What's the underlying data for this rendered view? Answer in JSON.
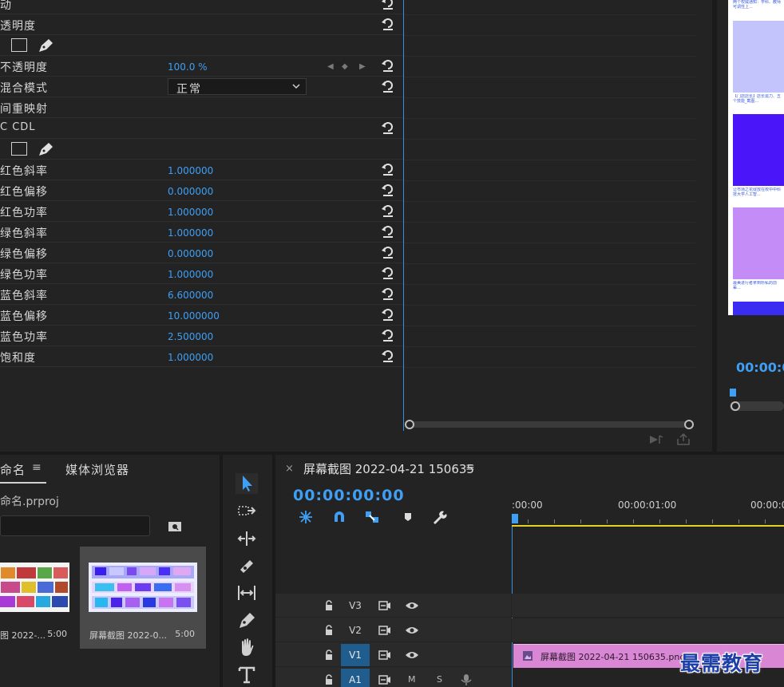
{
  "effect_controls": {
    "rows": [
      {
        "label": "动",
        "value": ""
      },
      {
        "label": "透明度",
        "value": ""
      },
      {
        "label": "",
        "value": ""
      },
      {
        "label": "不透明度",
        "value": "100.0 %"
      },
      {
        "label": "混合模式",
        "value": ""
      },
      {
        "label": "间重映射",
        "value": ""
      },
      {
        "label": "C CDL",
        "value": ""
      },
      {
        "label": "",
        "value": ""
      },
      {
        "label": "红色斜率",
        "value": "1.000000"
      },
      {
        "label": "红色偏移",
        "value": "0.000000"
      },
      {
        "label": "红色功率",
        "value": "1.000000"
      },
      {
        "label": "绿色斜率",
        "value": "1.000000"
      },
      {
        "label": "绿色偏移",
        "value": "0.000000"
      },
      {
        "label": "绿色功率",
        "value": "1.000000"
      },
      {
        "label": "蓝色斜率",
        "value": "6.600000"
      },
      {
        "label": "蓝色偏移",
        "value": "10.000000"
      },
      {
        "label": "蓝色功率",
        "value": "2.500000"
      },
      {
        "label": "饱和度",
        "value": "1.000000"
      }
    ],
    "blend_mode": "正常"
  },
  "program": {
    "timecode": "00:00:0",
    "cards": [
      {
        "caption": "两个权威通知：学科、教师可调性上..."
      },
      {
        "caption": "【门店店长】店长需力、五个技能_截图..."
      },
      {
        "caption": "让市场之花绽放在校中中科技大学人工智..."
      },
      {
        "caption": "最美进行者拿到所私的前辈..."
      }
    ]
  },
  "project": {
    "tab_name": "命名",
    "tab_menu": "≡",
    "tab_media": "媒体浏览器",
    "project_file": "命名.prproj",
    "items": [
      {
        "name": "图 2022-...",
        "duration": "5:00"
      },
      {
        "name": "屏幕截图 2022-0...",
        "duration": "5:00"
      }
    ]
  },
  "timeline": {
    "close": "×",
    "title": "屏幕截图 2022-04-21 150635",
    "menu": "≡",
    "timecode": "00:00:00:00",
    "ruler_ticks": [
      ":00:00",
      "00:00:01:00",
      "00:00:0"
    ],
    "tracks": [
      {
        "name": "V3",
        "active": false
      },
      {
        "name": "V2",
        "active": false
      },
      {
        "name": "V1",
        "active": true
      },
      {
        "name": "A1",
        "active": true
      }
    ],
    "audio_m": "M",
    "audio_s": "S",
    "clip_name": "屏幕截图 2022-04-21 150635.png"
  },
  "watermark": "最需教育",
  "colors": {
    "accent_blue": "#3e9ff5",
    "clip_pink": "#d987d5",
    "work_area_yellow": "#e4d21d"
  }
}
